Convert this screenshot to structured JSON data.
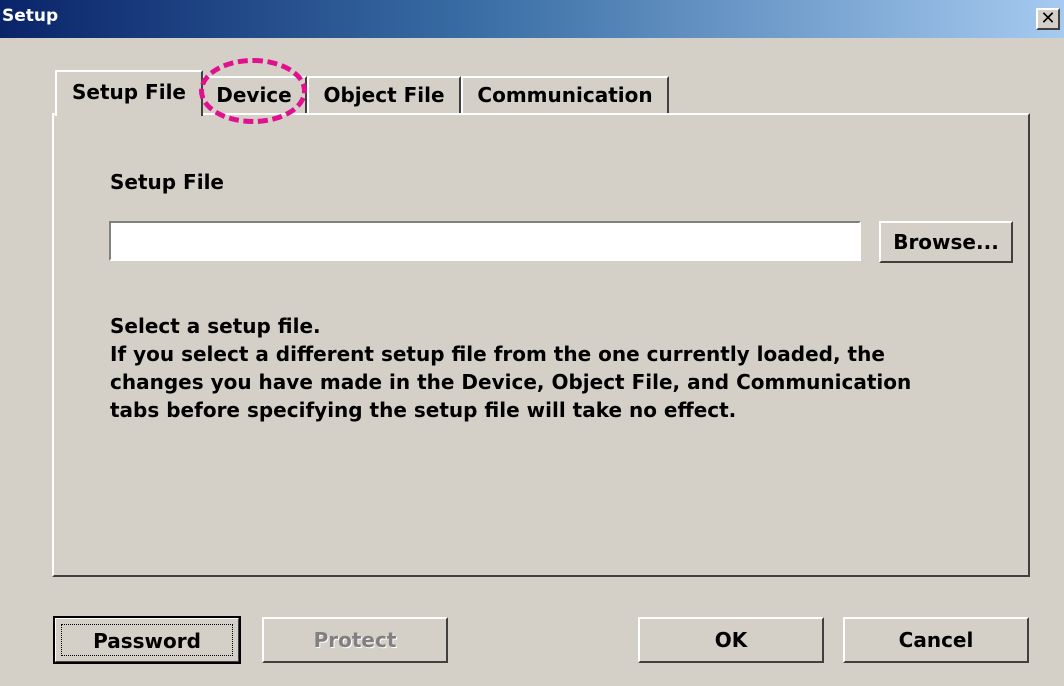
{
  "window": {
    "title": "Setup",
    "close_glyph": "✕"
  },
  "tabs": [
    {
      "label": "Setup File",
      "active": true
    },
    {
      "label": "Device",
      "active": false
    },
    {
      "label": "Object File",
      "active": false
    },
    {
      "label": "Communication",
      "active": false
    }
  ],
  "setup_file": {
    "section_label": "Setup File",
    "input_value": "",
    "browse_label": "Browse...",
    "help_lines": [
      "Select a setup file.",
      "If you select a different setup file from the one currently loaded, the",
      "changes you have made in the Device, Object File, and Communication",
      "tabs before specifying the setup file will take no effect."
    ]
  },
  "buttons": {
    "password": "Password",
    "protect": "Protect",
    "ok": "OK",
    "cancel": "Cancel"
  },
  "colors": {
    "titlebar_start": "#0a246a",
    "titlebar_end": "#a6caf0",
    "highlight": "#e0108f",
    "dialog_bg": "#d4d0c8"
  }
}
